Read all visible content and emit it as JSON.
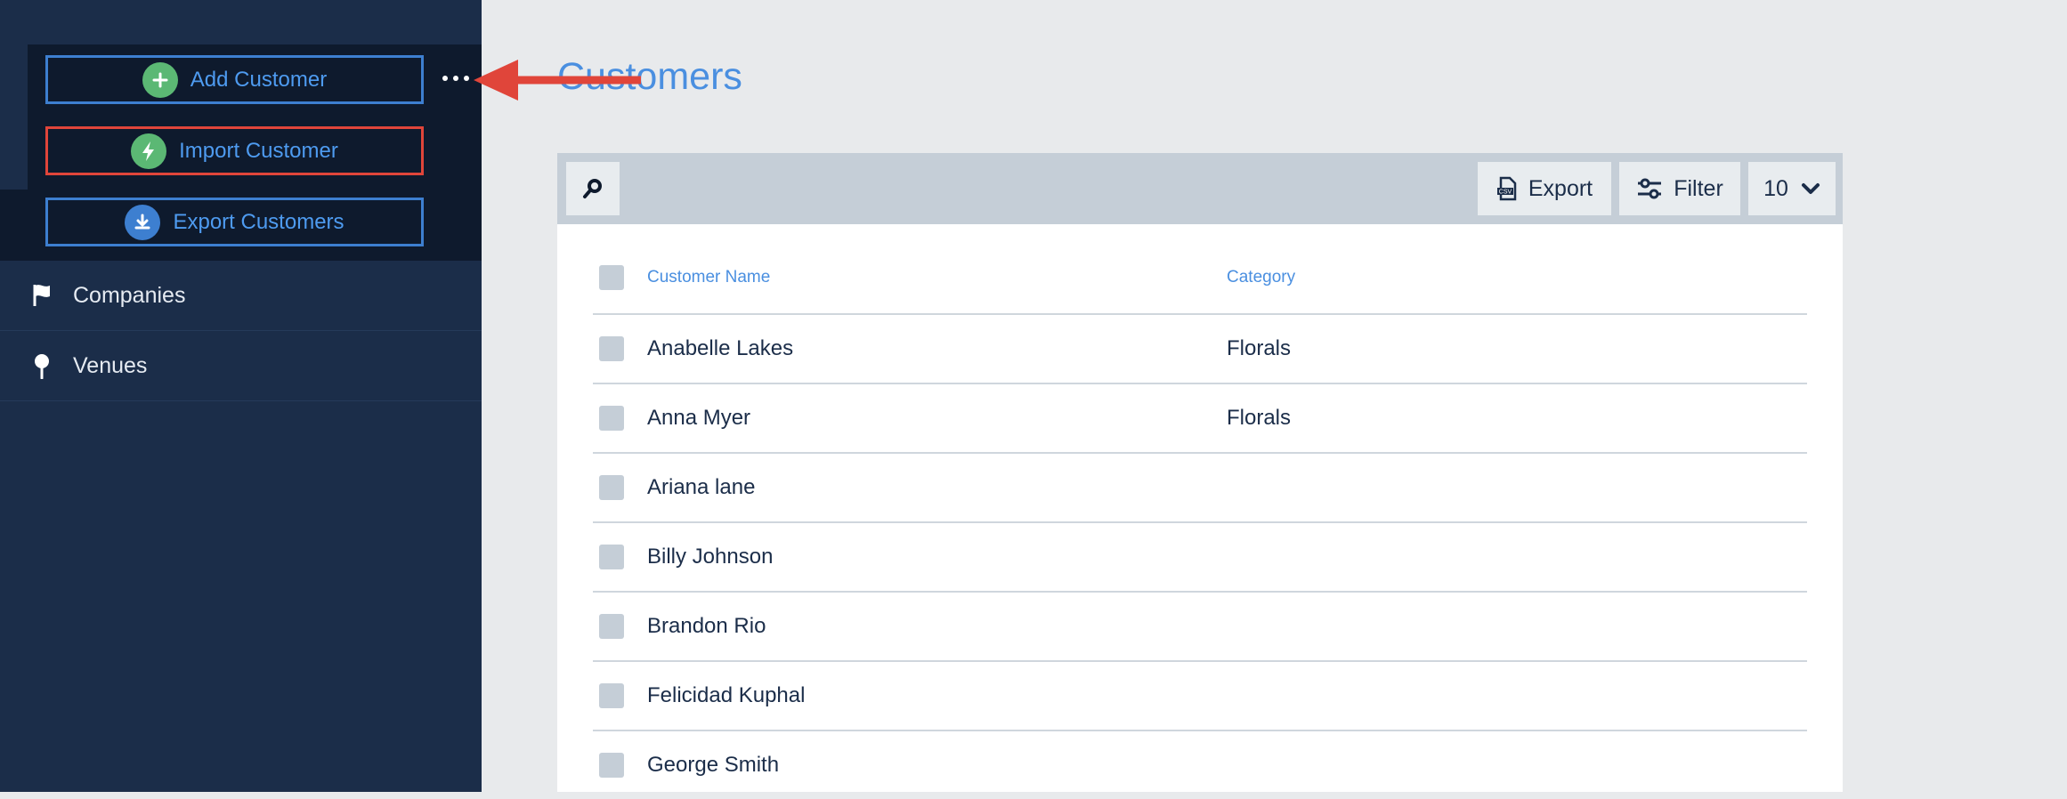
{
  "sidebar": {
    "dropdown": {
      "add_customer": "Add Customer",
      "import_customer": "Import Customer",
      "export_customers": "Export Customers"
    },
    "nav": [
      {
        "label": "Companies",
        "icon": "flag-icon"
      },
      {
        "label": "Venues",
        "icon": "map-pin-icon"
      }
    ]
  },
  "main": {
    "title": "Customers",
    "toolbar": {
      "export_label": "Export",
      "filter_label": "Filter",
      "per_page": "10"
    },
    "table": {
      "headers": {
        "name": "Customer Name",
        "category": "Category"
      },
      "rows": [
        {
          "name": "Anabelle Lakes",
          "category": "Florals"
        },
        {
          "name": "Anna Myer",
          "category": "Florals"
        },
        {
          "name": "Ariana lane",
          "category": ""
        },
        {
          "name": "Billy Johnson",
          "category": ""
        },
        {
          "name": "Brandon Rio",
          "category": ""
        },
        {
          "name": "Felicidad Kuphal",
          "category": ""
        },
        {
          "name": "George Smith",
          "category": ""
        }
      ]
    }
  },
  "colors": {
    "sidebar_bg": "#1b2d49",
    "accent_blue": "#4a8fe0",
    "highlight_red": "#e0453a",
    "icon_green": "#5bb874"
  }
}
